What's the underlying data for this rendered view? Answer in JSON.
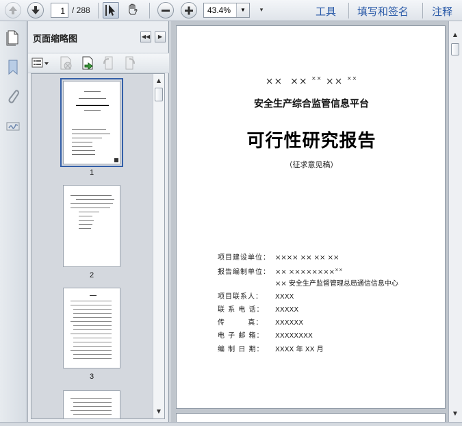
{
  "toolbar": {
    "current_page": "1",
    "page_count": "/ 288",
    "zoom": "43.4%",
    "tools_label": "工具",
    "sign_label": "填写和签名",
    "comment_label": "注释"
  },
  "panel": {
    "title": "页面缩略图",
    "thumbnails": [
      {
        "label": "1"
      },
      {
        "label": "2"
      },
      {
        "label": "3"
      },
      {
        "label": ""
      }
    ]
  },
  "document": {
    "org_placeholder": [
      "××",
      "××",
      "××",
      "××",
      "××"
    ],
    "platform_title": "安全生产综合监管信息平台",
    "report_title": "可行性研究报告",
    "draft_note": "（征求意见稿）",
    "info": [
      {
        "key": "项目建设单位：",
        "value": "×××× ×× ×× ××",
        "sup": ""
      },
      {
        "key": "报告编制单位：",
        "value": "×× ××××××××",
        "sup": "××"
      },
      {
        "key": "",
        "value": "×× 安全生产监督管理总局通信信息中心",
        "sup": ""
      },
      {
        "key": "项目联系人：",
        "value": "XXXX",
        "sup": ""
      },
      {
        "key": "联 系 电 话：",
        "value": "XXXXX",
        "sup": ""
      },
      {
        "key": "传        真：",
        "value": "XXXXXX",
        "sup": ""
      },
      {
        "key": "电 子 邮 箱：",
        "value": "XXXXXXXX",
        "sup": ""
      },
      {
        "key": "编 制 日 期：",
        "value": "XXXX 年 XX 月",
        "sup": ""
      }
    ]
  },
  "colors": {
    "accent": "#2a5aa8",
    "selection": "#335fa8"
  },
  "icons": [
    "prev-page-icon",
    "next-page-icon",
    "select-tool-icon",
    "hand-tool-icon",
    "zoom-out-icon",
    "zoom-in-icon",
    "pages-icon",
    "bookmark-icon",
    "attachment-icon",
    "signature-icon",
    "thumbnail-options-icon",
    "delete-page-icon",
    "extract-page-icon",
    "rotate-ccw-icon",
    "rotate-cw-icon"
  ]
}
